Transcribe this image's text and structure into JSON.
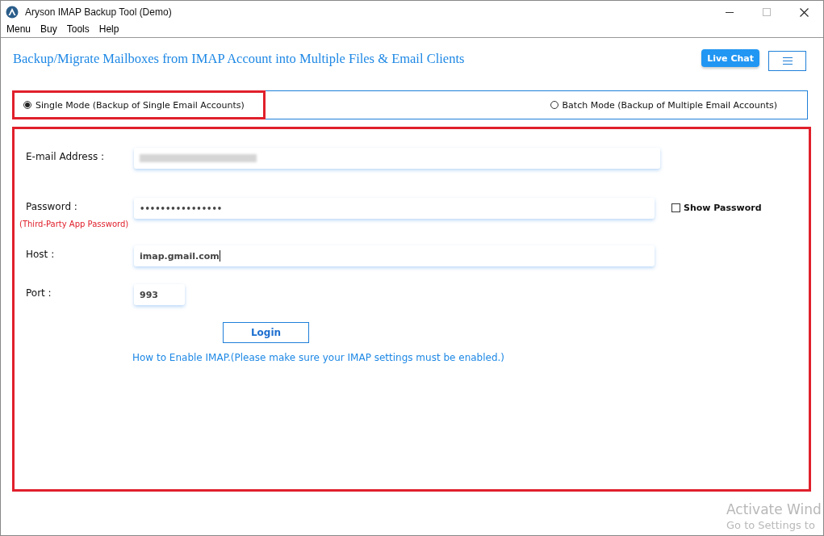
{
  "window": {
    "title": "Aryson IMAP Backup Tool (Demo)"
  },
  "menu": [
    "Menu",
    "Buy",
    "Tools",
    "Help"
  ],
  "header": {
    "title": "Backup/Migrate Mailboxes from IMAP Account into Multiple Files & Email Clients",
    "live_chat": "Live Chat"
  },
  "modes": [
    {
      "label": "Single Mode (Backup of Single Email Accounts)",
      "selected": true
    },
    {
      "label": "Batch Mode (Backup of Multiple Email Accounts)",
      "selected": false
    }
  ],
  "form": {
    "fields": [
      {
        "label": "E-mail Address :",
        "kind": "blurred"
      },
      {
        "label": "Password :",
        "value": "••••••••••••••••",
        "note": "(Third-Party App Password)",
        "kind": "password"
      },
      {
        "label": "Host :",
        "value": "imap.gmail.com",
        "kind": "text",
        "focused": true
      },
      {
        "label": "Port :",
        "value": "993",
        "kind": "short"
      }
    ],
    "show_password": {
      "label": "Show Password",
      "checked": false
    },
    "login": "Login",
    "help_link": "How to Enable IMAP.(Please make sure your IMAP settings must be enabled.)"
  },
  "os_overlay": [
    "Activate Wind",
    "Go to Settings to"
  ]
}
